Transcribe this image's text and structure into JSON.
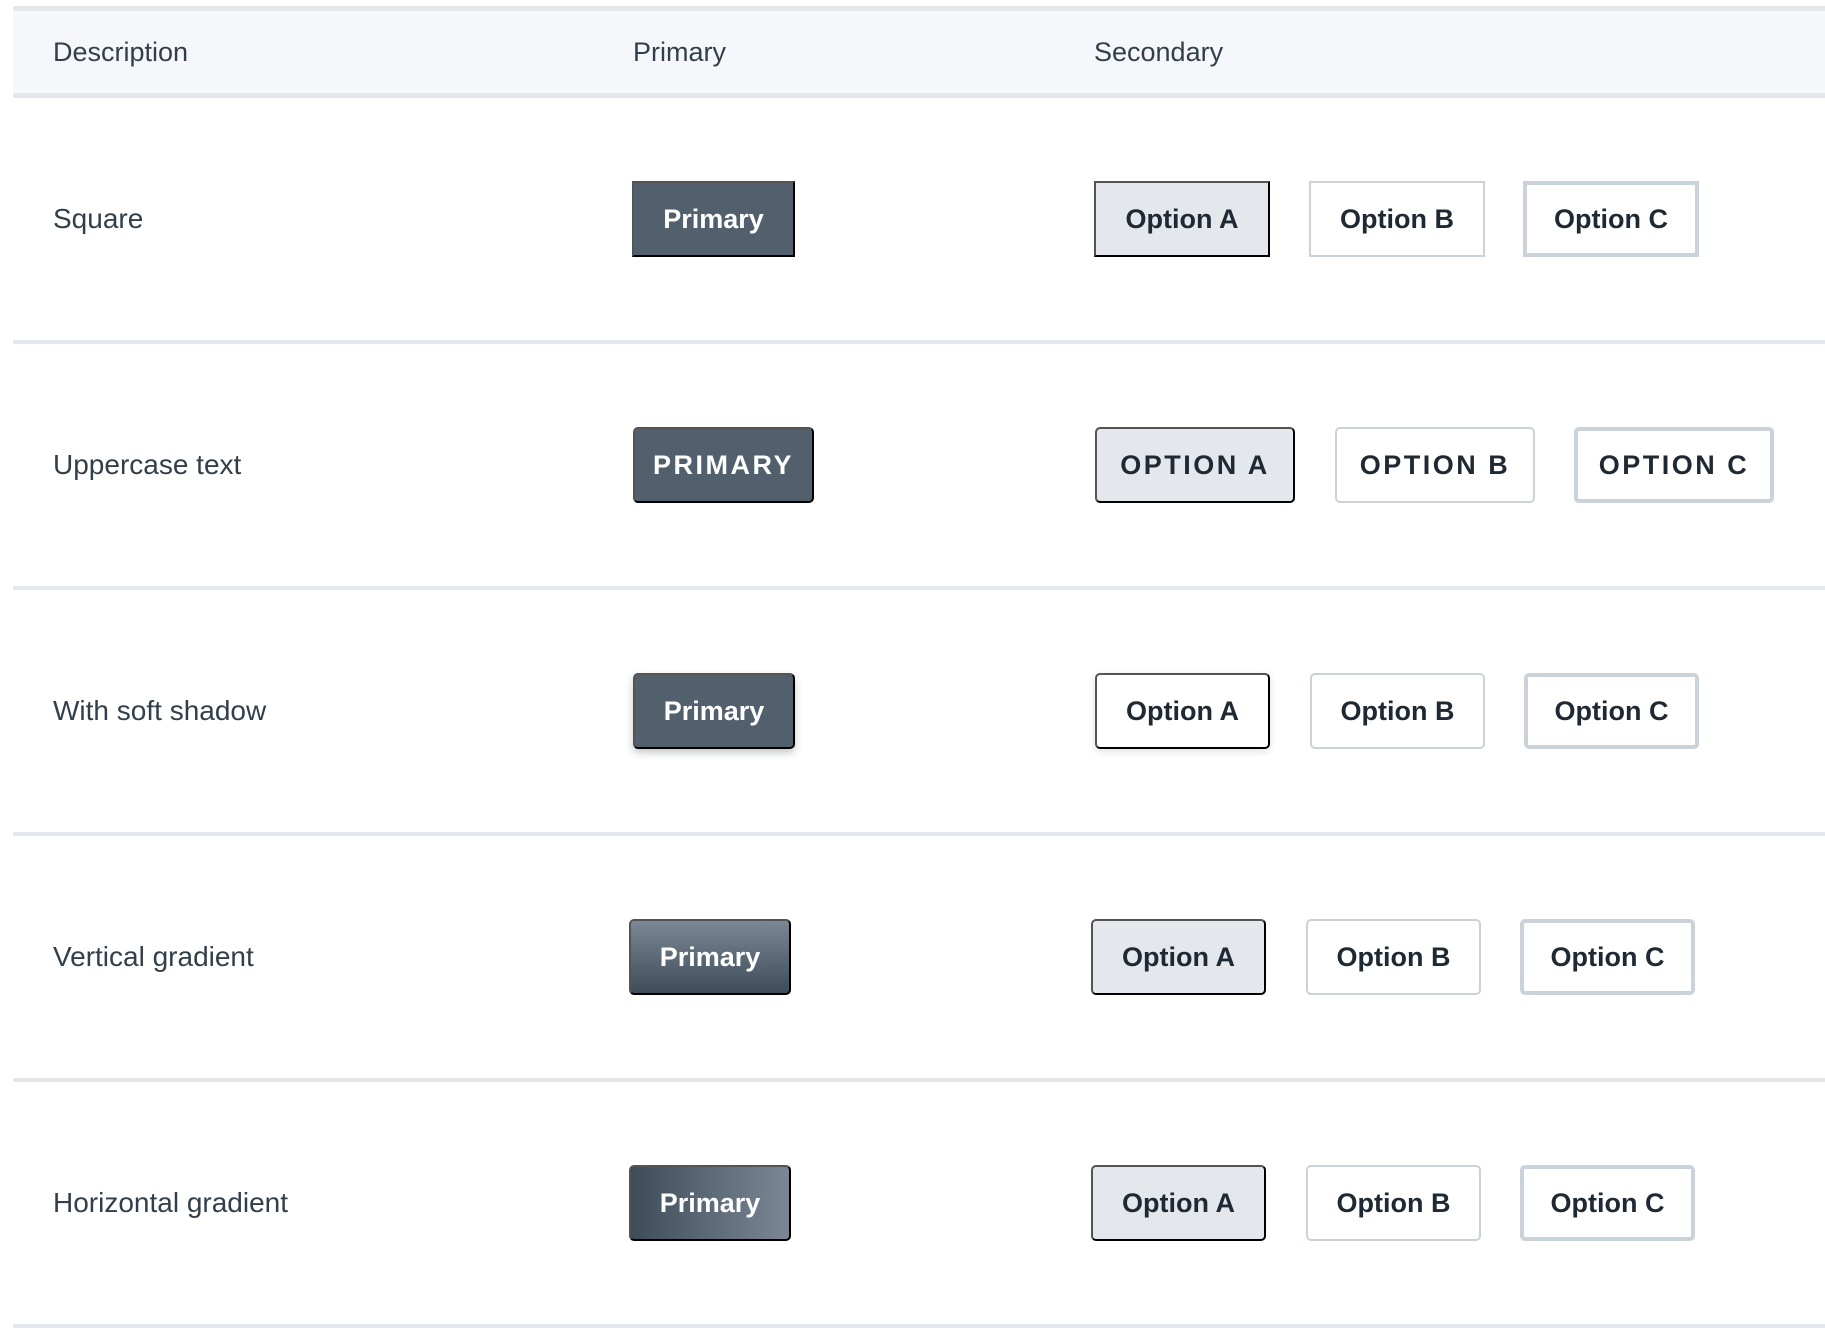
{
  "header": {
    "description": "Description",
    "primary": "Primary",
    "secondary": "Secondary"
  },
  "rows": [
    {
      "description": "Square",
      "primary": "Primary",
      "option_a": "Option A",
      "option_b": "Option B",
      "option_c": "Option C"
    },
    {
      "description": "Uppercase text",
      "primary": "Primary",
      "option_a": "Option A",
      "option_b": "Option B",
      "option_c": "Option C"
    },
    {
      "description": "With soft shadow",
      "primary": "Primary",
      "option_a": "Option A",
      "option_b": "Option B",
      "option_c": "Option C"
    },
    {
      "description": "Vertical gradient",
      "primary": "Primary",
      "option_a": "Option A",
      "option_b": "Option B",
      "option_c": "Option C"
    },
    {
      "description": "Horizontal gradient",
      "primary": "Primary",
      "option_a": "Option A",
      "option_b": "Option B",
      "option_c": "Option C"
    }
  ],
  "colors": {
    "primary_bg": "#52606d",
    "secondary_bg": "#e4e7eb",
    "border": "#cbd2d9",
    "header_bg": "#f5f7fa",
    "text": "#1f2933"
  }
}
